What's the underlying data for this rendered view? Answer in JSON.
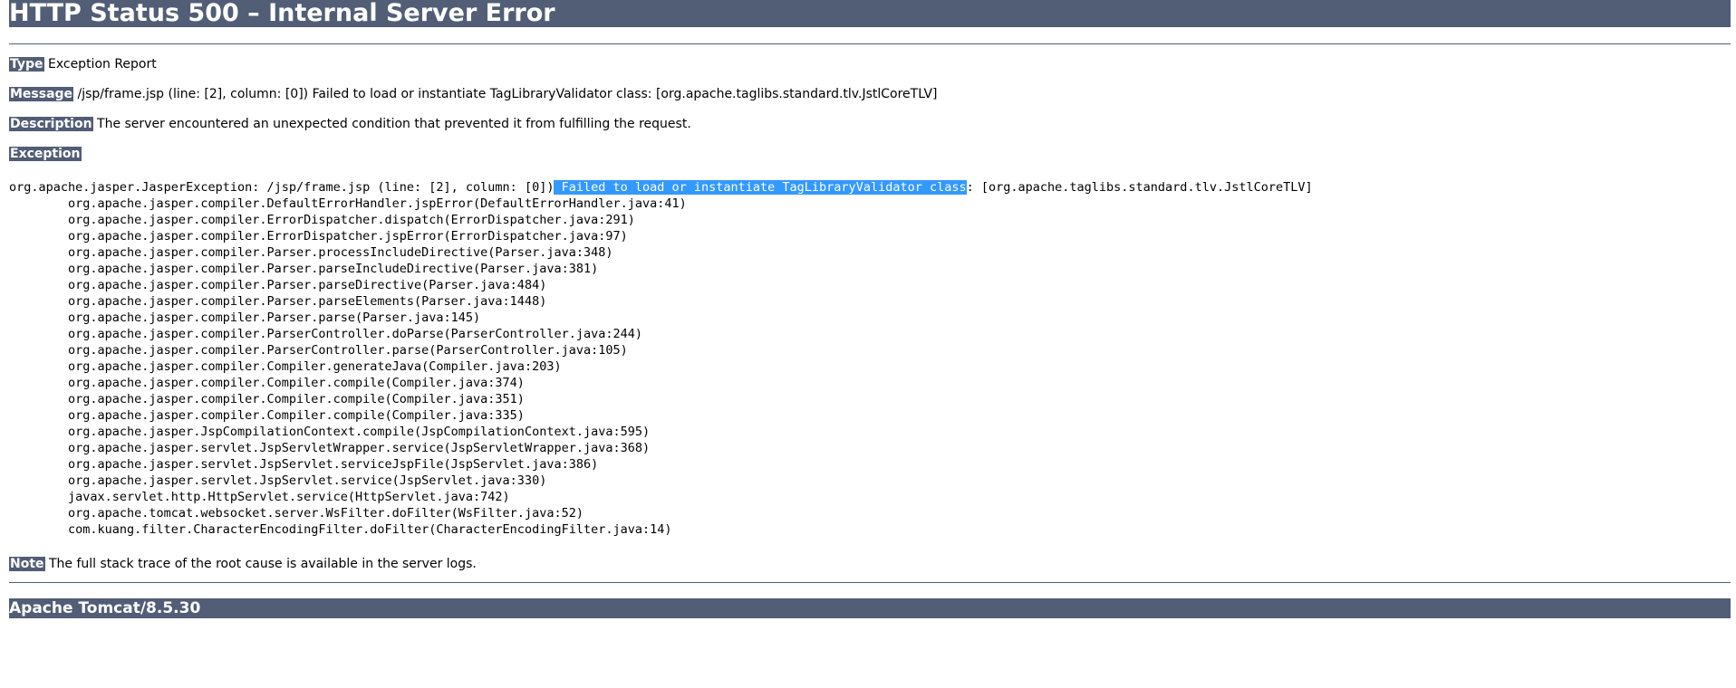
{
  "title": "HTTP Status 500 – Internal Server Error",
  "rows": {
    "type": {
      "label": "Type",
      "text": " Exception Report"
    },
    "message": {
      "label": "Message",
      "text": " /jsp/frame.jsp (line: [2], column: [0]) Failed to load or instantiate TagLibraryValidator class: [org.apache.taglibs.standard.tlv.JstlCoreTLV]"
    },
    "description": {
      "label": "Description",
      "text": " The server encountered an unexpected condition that prevented it from fulfilling the request."
    },
    "exception": {
      "label": "Exception"
    },
    "note": {
      "label": "Note",
      "text": " The full stack trace of the root cause is available in the server logs."
    }
  },
  "exception_trace": {
    "first_line_prefix": "org.apache.jasper.JasperException: /jsp/frame.jsp (line: [2], column: [0])",
    "first_line_highlight": " Failed to load or instantiate TagLibraryValidator class",
    "first_line_suffix": ": [org.apache.taglibs.standard.tlv.JstlCoreTLV]",
    "frames": [
      "\torg.apache.jasper.compiler.DefaultErrorHandler.jspError(DefaultErrorHandler.java:41)",
      "\torg.apache.jasper.compiler.ErrorDispatcher.dispatch(ErrorDispatcher.java:291)",
      "\torg.apache.jasper.compiler.ErrorDispatcher.jspError(ErrorDispatcher.java:97)",
      "\torg.apache.jasper.compiler.Parser.processIncludeDirective(Parser.java:348)",
      "\torg.apache.jasper.compiler.Parser.parseIncludeDirective(Parser.java:381)",
      "\torg.apache.jasper.compiler.Parser.parseDirective(Parser.java:484)",
      "\torg.apache.jasper.compiler.Parser.parseElements(Parser.java:1448)",
      "\torg.apache.jasper.compiler.Parser.parse(Parser.java:145)",
      "\torg.apache.jasper.compiler.ParserController.doParse(ParserController.java:244)",
      "\torg.apache.jasper.compiler.ParserController.parse(ParserController.java:105)",
      "\torg.apache.jasper.compiler.Compiler.generateJava(Compiler.java:203)",
      "\torg.apache.jasper.compiler.Compiler.compile(Compiler.java:374)",
      "\torg.apache.jasper.compiler.Compiler.compile(Compiler.java:351)",
      "\torg.apache.jasper.compiler.Compiler.compile(Compiler.java:335)",
      "\torg.apache.jasper.JspCompilationContext.compile(JspCompilationContext.java:595)",
      "\torg.apache.jasper.servlet.JspServletWrapper.service(JspServletWrapper.java:368)",
      "\torg.apache.jasper.servlet.JspServlet.serviceJspFile(JspServlet.java:386)",
      "\torg.apache.jasper.servlet.JspServlet.service(JspServlet.java:330)",
      "\tjavax.servlet.http.HttpServlet.service(HttpServlet.java:742)",
      "\torg.apache.tomcat.websocket.server.WsFilter.doFilter(WsFilter.java:52)",
      "\tcom.kuang.filter.CharacterEncodingFilter.doFilter(CharacterEncodingFilter.java:14)"
    ]
  },
  "footer": "Apache Tomcat/8.5.30",
  "colors": {
    "header_bg": "#525d76",
    "selection_highlight": "#3399ff"
  }
}
